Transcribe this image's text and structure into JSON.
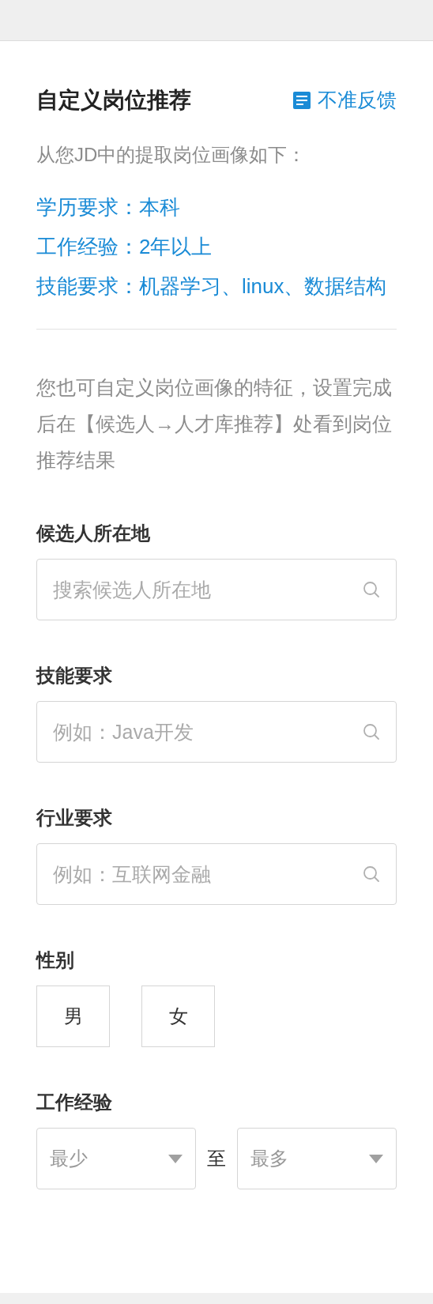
{
  "header": {
    "title": "自定义岗位推荐",
    "feedback": "不准反馈"
  },
  "intro": "从您JD中的提取岗位画像如下：",
  "profile": [
    {
      "label": "学历要求：",
      "value": "本科"
    },
    {
      "label": "工作经验：",
      "value": "2年以上"
    },
    {
      "label": "技能要求：",
      "value": "机器学习、linux、数据结构"
    }
  ],
  "hint": "您也可自定义岗位画像的特征，设置完成后在【候选人→人才库推荐】处看到岗位推荐结果",
  "fields": [
    {
      "label": "候选人所在地",
      "placeholder": "搜索候选人所在地"
    },
    {
      "label": "技能要求",
      "placeholder": "例如：Java开发"
    },
    {
      "label": "行业要求",
      "placeholder": "例如：互联网金融"
    }
  ],
  "gender": {
    "label": "性别",
    "options": [
      {
        "label": "男",
        "selected": false
      },
      {
        "label": "女",
        "selected": false
      }
    ]
  },
  "experience": {
    "label": "工作经验",
    "min": "最少",
    "separator": "至",
    "max": "最多"
  }
}
